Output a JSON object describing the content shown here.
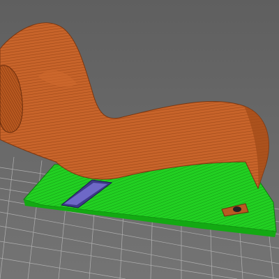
{
  "scene": {
    "background_color": "#6a6a6a",
    "bed_grid_color": "#c8c8c8",
    "part_main_color": "#c8642a",
    "part_shadow_color": "#8a3f16",
    "support_color": "#1fcf1f",
    "support_edge_color": "#128812",
    "overhang_color": "#6b63c9",
    "shading": "layer-lines"
  }
}
